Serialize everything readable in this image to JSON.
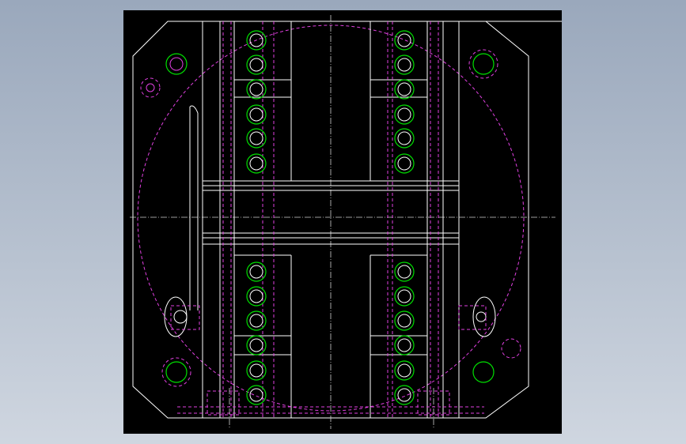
{
  "viewport": {
    "background": "#000000",
    "frame_color": "#ffffff",
    "hidden_line_color": "#e040e0",
    "bolt_color": "#00e000",
    "center_line_color": "#d0d0d0"
  },
  "icons": {
    "background_gradient": "gradient-backdrop"
  }
}
